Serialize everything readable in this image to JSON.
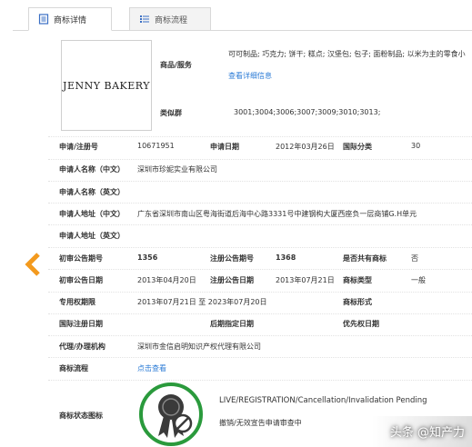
{
  "tabs": {
    "detail_label": "商标详情",
    "flow_label": "商标流程"
  },
  "logo": {
    "text": "JENNY BAKERY"
  },
  "goods": {
    "label": "商品/服务",
    "value": "可可制品; 巧克力; 饼干; 糕点; 汉堡包; 包子; 面粉制品; 以米为主的零食小",
    "detail_link": "查看详细信息"
  },
  "similar_group": {
    "label": "类似群",
    "value": "3001;3004;3006;3007;3009;3010;3013;"
  },
  "fields": {
    "reg_no_label": "申请/注册号",
    "reg_no": "10671951",
    "apply_date_label": "申请日期",
    "apply_date": "2012年03月26日",
    "intl_class_label": "国际分类",
    "intl_class": "30",
    "applicant_cn_label": "申请人名称（中文）",
    "applicant_cn": "深圳市珍妮实业有限公司",
    "applicant_en_label": "申请人名称（英文）",
    "address_cn_label": "申请人地址（中文）",
    "address_cn": "广东省深圳市南山区粤海街道后海中心路3331号中建钢构大厦西座负一层商铺G.H单元",
    "address_en_label": "申请人地址（英文）",
    "prelim_no_label": "初审公告期号",
    "prelim_no": "1356",
    "reg_pub_no_label": "注册公告期号",
    "reg_pub_no": "1368",
    "shared_label": "是否共有商标",
    "shared": "否",
    "prelim_date_label": "初审公告日期",
    "prelim_date": "2013年04月20日",
    "reg_pub_date_label": "注册公告日期",
    "reg_pub_date": "2013年07月21日",
    "tm_type_label": "商标类型",
    "tm_type": "一般",
    "exclusive_label": "专用权期限",
    "exclusive": "2013年07月21日 至 2023年07月20日",
    "tm_form_label": "商标形式",
    "intl_reg_date_label": "国际注册日期",
    "later_date_label": "后期指定日期",
    "priority_date_label": "优先权日期",
    "agent_label": "代理/办理机构",
    "agent": "深圳市金信启明知识产权代理有限公司",
    "flow_label": "商标流程",
    "flow_link": "点击查看",
    "status_label": "商标状态图标",
    "status_en": "LIVE/REGISTRATION/Cancellation/Invalidation Pending",
    "status_cn": "撤销/无效宣告申请审查中"
  },
  "watermark": "头条 @知产力",
  "colors": {
    "accent_blue": "#2b7bd6",
    "arrow_orange": "#f39a1e",
    "status_green": "#2a9a3c"
  },
  "icons": {
    "detail_tab": "document-icon",
    "flow_tab": "list-icon",
    "prev": "prev-arrow-icon",
    "status": "award-prohibited-icon"
  }
}
